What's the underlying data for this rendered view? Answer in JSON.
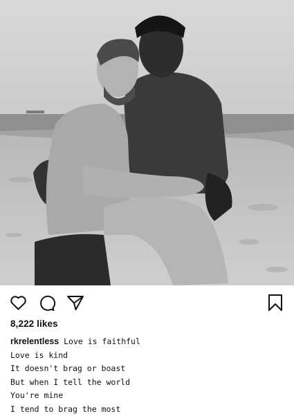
{
  "post": {
    "photo": {
      "icon": "photo-image",
      "description_hidden": true,
      "tones": {
        "sky": "#d4d4d4",
        "sea": "#8e8e8e",
        "sand": "#bdbdbd",
        "skin_light": "#a8a8a8",
        "skin_dark": "#2e2e2e",
        "shorts": "#2a2a2a"
      }
    },
    "actions": {
      "like_icon": "heart-icon",
      "comment_icon": "comment-icon",
      "share_icon": "share-icon",
      "save_icon": "bookmark-icon"
    },
    "likes": "8,222 likes",
    "caption": {
      "username": "rkrelentless",
      "first_line": "Love is faithful",
      "lines": [
        "Love is kind",
        "It doesn't brag or boast",
        "But when I tell the world",
        "You're mine",
        "I tend to brag the most"
      ]
    }
  }
}
